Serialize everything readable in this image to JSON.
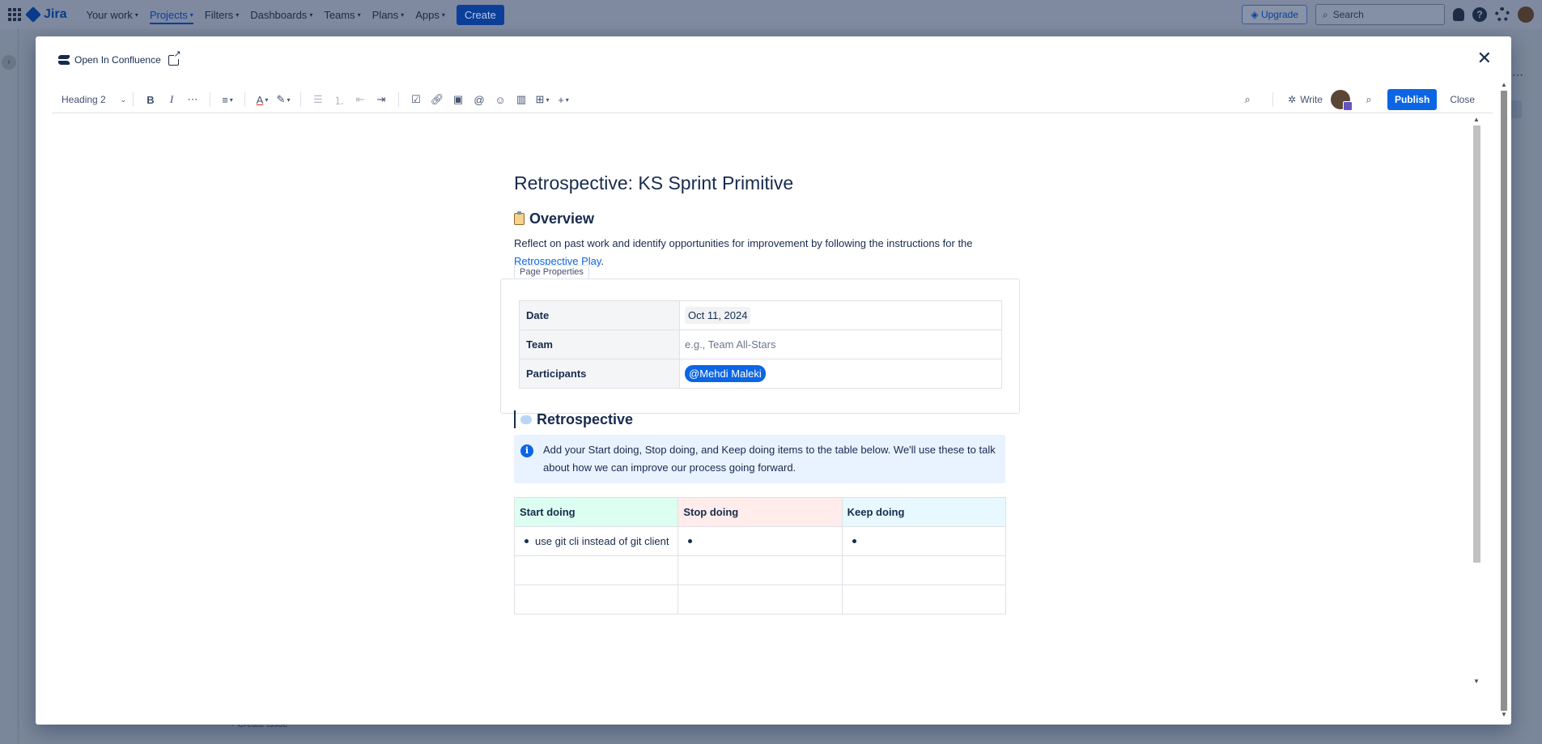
{
  "jira_nav": {
    "logo": "Jira",
    "items": [
      {
        "label": "Your work"
      },
      {
        "label": "Projects"
      },
      {
        "label": "Filters"
      },
      {
        "label": "Dashboards"
      },
      {
        "label": "Teams"
      },
      {
        "label": "Plans"
      },
      {
        "label": "Apps"
      }
    ],
    "create_label": "Create",
    "upgrade_label": "Upgrade",
    "search_placeholder": "Search"
  },
  "background": {
    "create_issue": "Create issue"
  },
  "modal": {
    "open_in_confluence": "Open In Confluence",
    "close_icon": "close-icon"
  },
  "toolbar": {
    "text_style": "Heading 2",
    "write_label": "Write",
    "publish_label": "Publish",
    "close_label": "Close"
  },
  "page": {
    "title": "Retrospective: KS Sprint Primitive",
    "overview_heading": "Overview",
    "intro_text": "Reflect on past work and identify opportunities for improvement by following the instructions for the ",
    "intro_link": "Retrospective Play",
    "intro_end": ".",
    "macro_label": "Page Properties",
    "properties": {
      "date_label": "Date",
      "date_value": "Oct 11, 2024",
      "team_label": "Team",
      "team_placeholder": "e.g., Team All-Stars",
      "participants_label": "Participants",
      "participant_mention": "@Mehdi Maleki"
    },
    "retro_heading": "Retrospective",
    "info_text": "Add your Start doing, Stop doing, and Keep doing items to the table below. We'll use these to talk about how we can improve our process going forward.",
    "retro_table": {
      "headers": [
        "Start doing",
        "Stop doing",
        "Keep doing"
      ],
      "row1": [
        "use git cli instead of git client",
        "",
        ""
      ]
    }
  },
  "colors": {
    "primary": "#0c66e4",
    "start_header": "#dcfff1",
    "stop_header": "#ffeceb",
    "keep_header": "#e7f9ff",
    "info_panel": "#e9f2ff"
  }
}
